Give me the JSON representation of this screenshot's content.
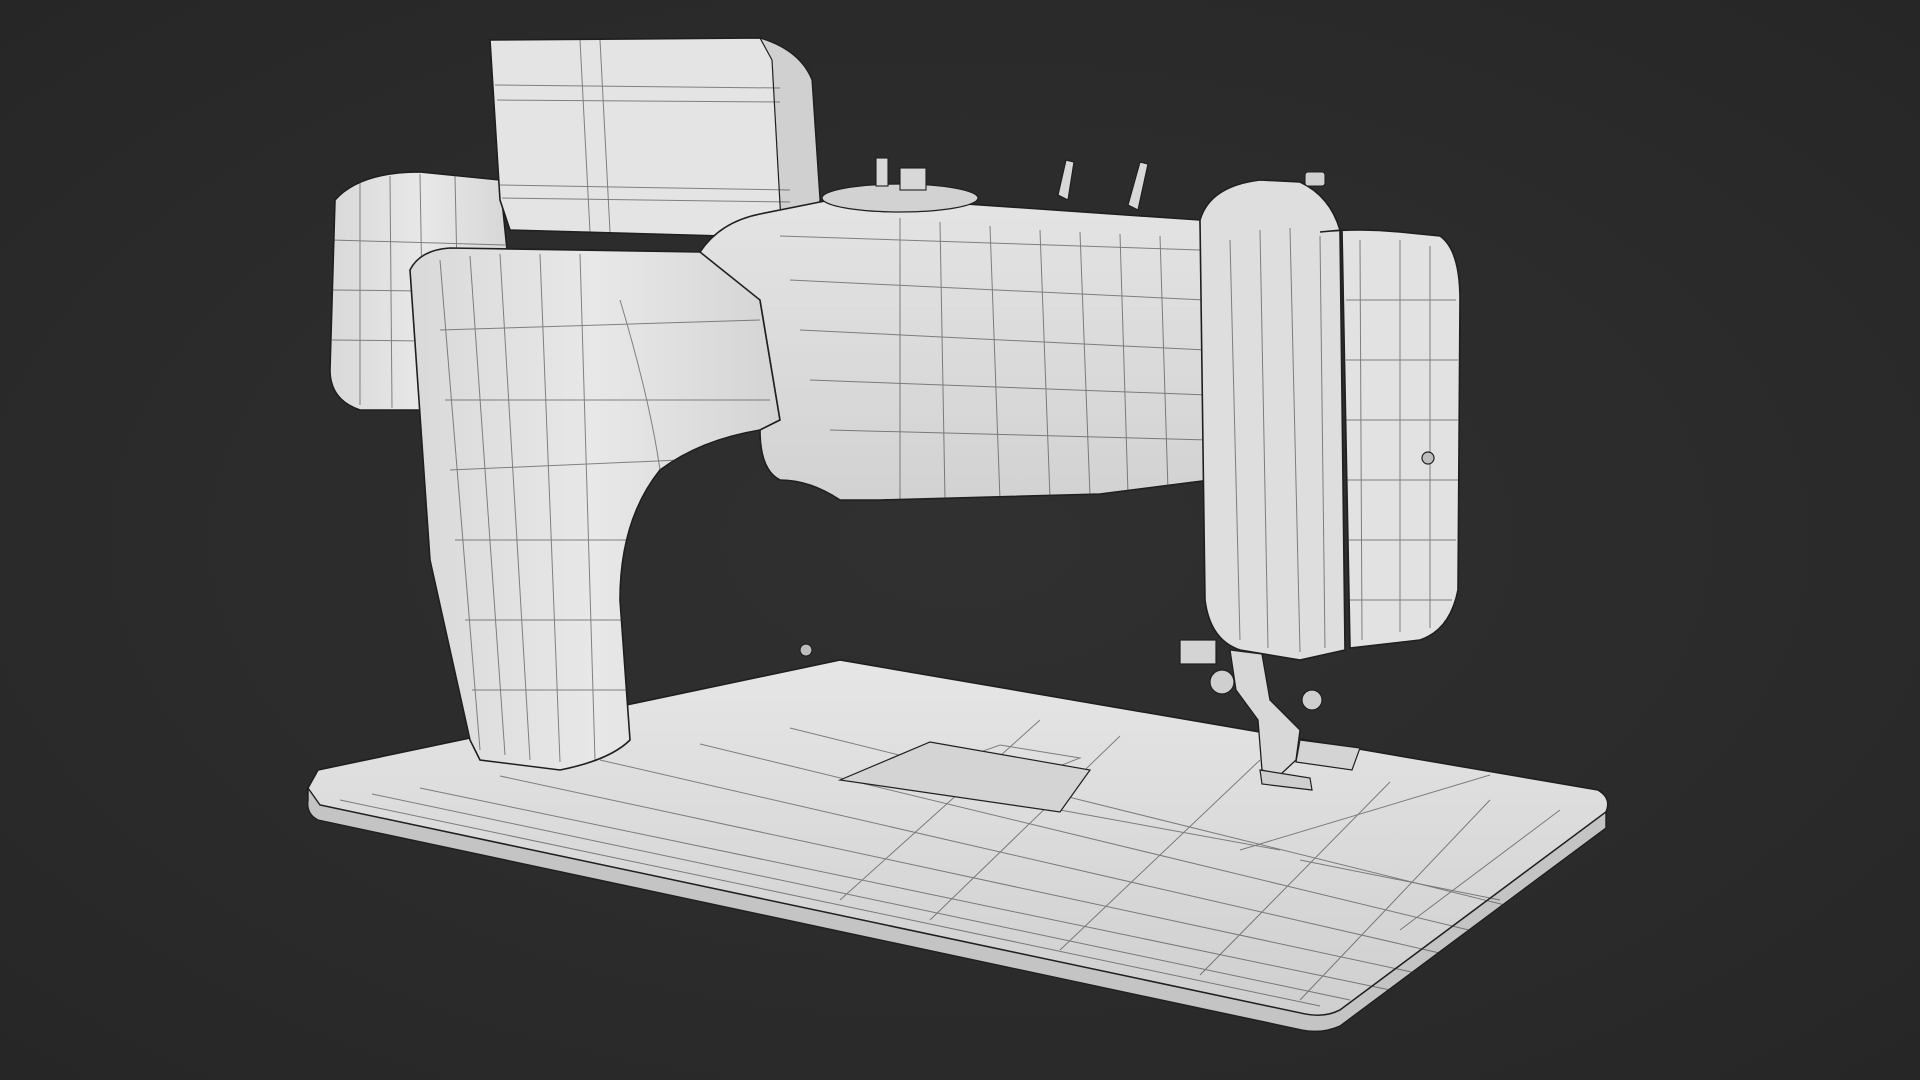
{
  "scene": {
    "subject": "sewing-machine-wireframe",
    "background_color": "#2b2b2b",
    "surface_color": "#dcdcdc",
    "wire_color": "#2e2e2e"
  }
}
